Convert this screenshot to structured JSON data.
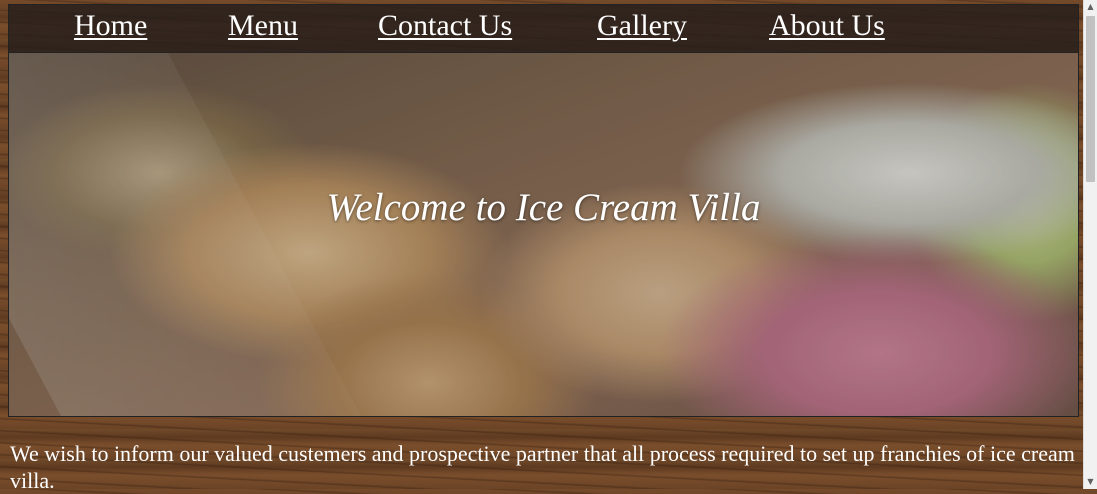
{
  "nav": {
    "items": [
      {
        "label": "Home"
      },
      {
        "label": "Menu"
      },
      {
        "label": "Contact Us"
      },
      {
        "label": "Gallery"
      },
      {
        "label": "About Us"
      }
    ]
  },
  "hero": {
    "title": "Welcome to Ice Cream Villa"
  },
  "intro": {
    "text": "We wish to inform our valued custemers and prospective partner that all process required to set up franchies of ice cream villa."
  },
  "scrollbar": {
    "up_icon": "scroll-up-arrow-icon",
    "down_icon": "scroll-down-arrow-icon"
  }
}
